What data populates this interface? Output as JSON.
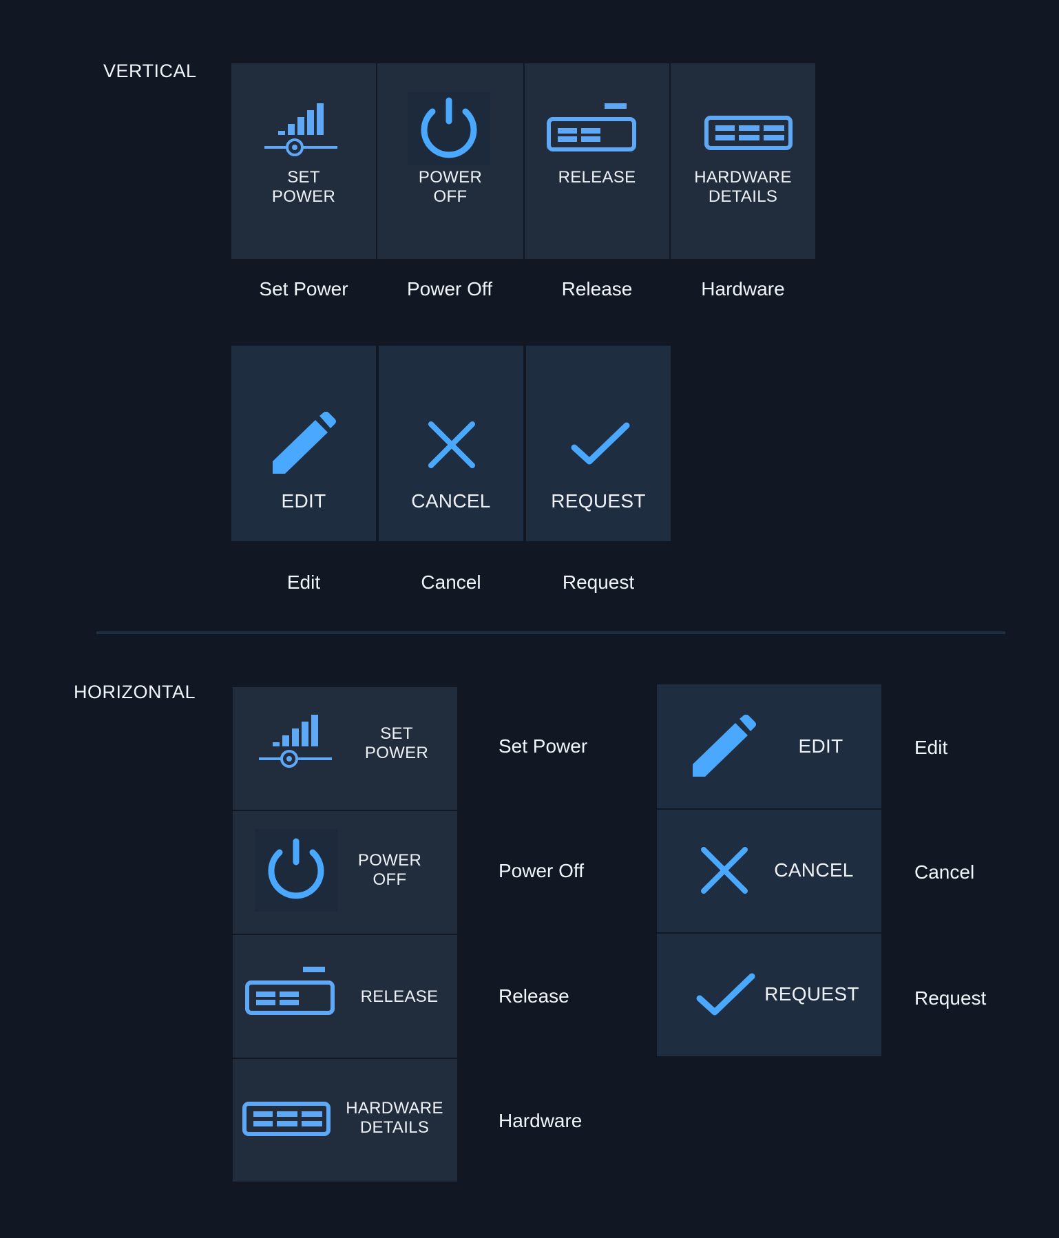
{
  "colors": {
    "background": "#111823",
    "tile": "#212c3c",
    "tile_alt": "#1e2d40",
    "icon_light_blue": "#5fa8f5",
    "icon_blue": "#4aa8ff",
    "divider": "#1f2f42",
    "text": "#eef2f7"
  },
  "vertical": {
    "label": "VERTICAL",
    "row1": [
      {
        "icon": "set-power-icon",
        "label": "SET\nPOWER",
        "caption": "Set Power"
      },
      {
        "icon": "power-icon",
        "label": "POWER\nOFF",
        "caption": "Power Off"
      },
      {
        "icon": "release-icon",
        "label": "RELEASE",
        "caption": "Release"
      },
      {
        "icon": "hardware-icon",
        "label": "HARDWARE\nDETAILS",
        "caption": "Hardware"
      }
    ],
    "row2": [
      {
        "icon": "pencil-icon",
        "label": "EDIT",
        "caption": "Edit"
      },
      {
        "icon": "close-icon",
        "label": "CANCEL",
        "caption": "Cancel"
      },
      {
        "icon": "check-icon",
        "label": "REQUEST",
        "caption": "Request"
      }
    ]
  },
  "horizontal": {
    "label": "HORIZONTAL",
    "left": [
      {
        "icon": "set-power-icon",
        "label": "SET\nPOWER",
        "caption": "Set Power"
      },
      {
        "icon": "power-icon",
        "label": "POWER\nOFF",
        "caption": "Power Off"
      },
      {
        "icon": "release-icon",
        "label": "RELEASE",
        "caption": "Release"
      },
      {
        "icon": "hardware-icon",
        "label": "HARDWARE\nDETAILS",
        "caption": "Hardware"
      }
    ],
    "right": [
      {
        "icon": "pencil-icon",
        "label": "EDIT",
        "caption": "Edit"
      },
      {
        "icon": "close-icon",
        "label": "CANCEL",
        "caption": "Cancel"
      },
      {
        "icon": "check-icon",
        "label": "REQUEST",
        "caption": "Request"
      }
    ]
  }
}
